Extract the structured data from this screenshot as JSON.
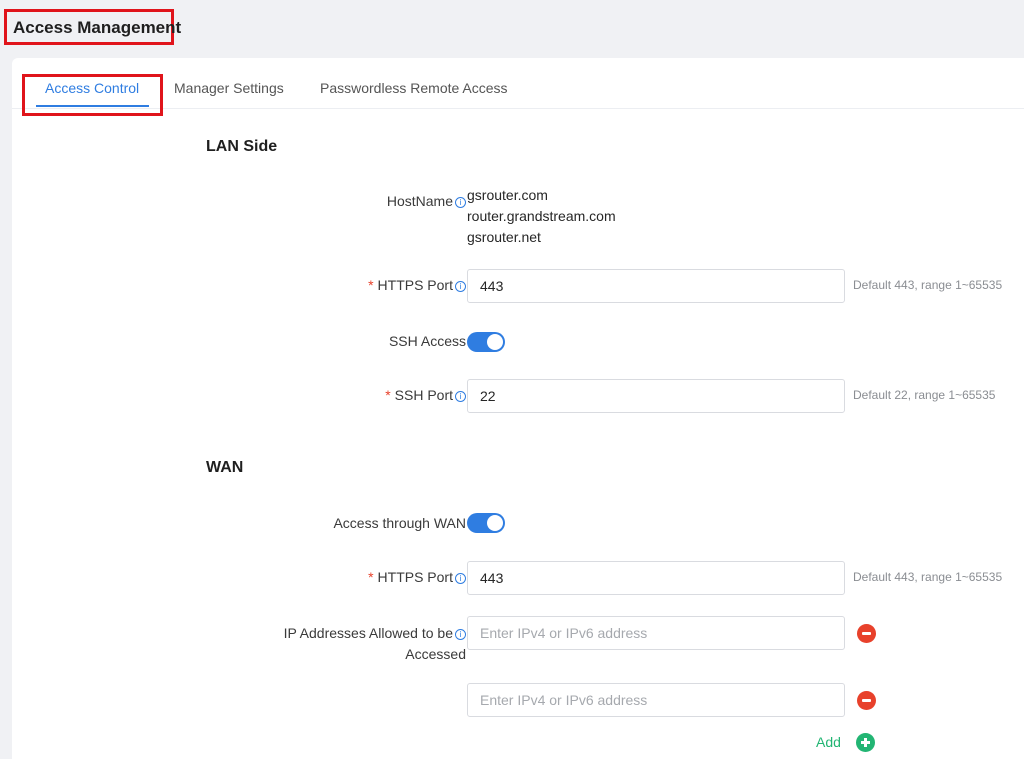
{
  "header": {
    "title": "Access Management"
  },
  "tabs": [
    {
      "label": "Access Control",
      "active": true
    },
    {
      "label": "Manager Settings",
      "active": false
    },
    {
      "label": "Passwordless Remote Access",
      "active": false
    }
  ],
  "lan": {
    "title": "LAN Side",
    "hostname_label": "HostName",
    "hostnames": [
      "gsrouter.com",
      "router.grandstream.com",
      "gsrouter.net"
    ],
    "https_port_label": "HTTPS Port",
    "https_port_value": "443",
    "https_port_hint": "Default 443, range 1~65535",
    "ssh_access_label": "SSH Access",
    "ssh_access_enabled": true,
    "ssh_port_label": "SSH Port",
    "ssh_port_value": "22",
    "ssh_port_hint": "Default 22, range 1~65535"
  },
  "wan": {
    "title": "WAN",
    "access_label": "Access through WAN",
    "access_enabled": true,
    "https_port_label": "HTTPS Port",
    "https_port_value": "443",
    "https_port_hint": "Default 443, range 1~65535",
    "ip_label_line1": "IP Addresses Allowed to be",
    "ip_label_line2": "Accessed",
    "ip_placeholder": "Enter IPv4 or IPv6 address",
    "add_label": "Add"
  },
  "icons": {
    "info": "info-circle-icon",
    "remove": "minus-circle-icon",
    "add": "plus-circle-icon"
  },
  "colors": {
    "accent": "#2f7de1",
    "required": "#e8412b",
    "add": "#22b573",
    "highlight_box": "#e0141b"
  }
}
